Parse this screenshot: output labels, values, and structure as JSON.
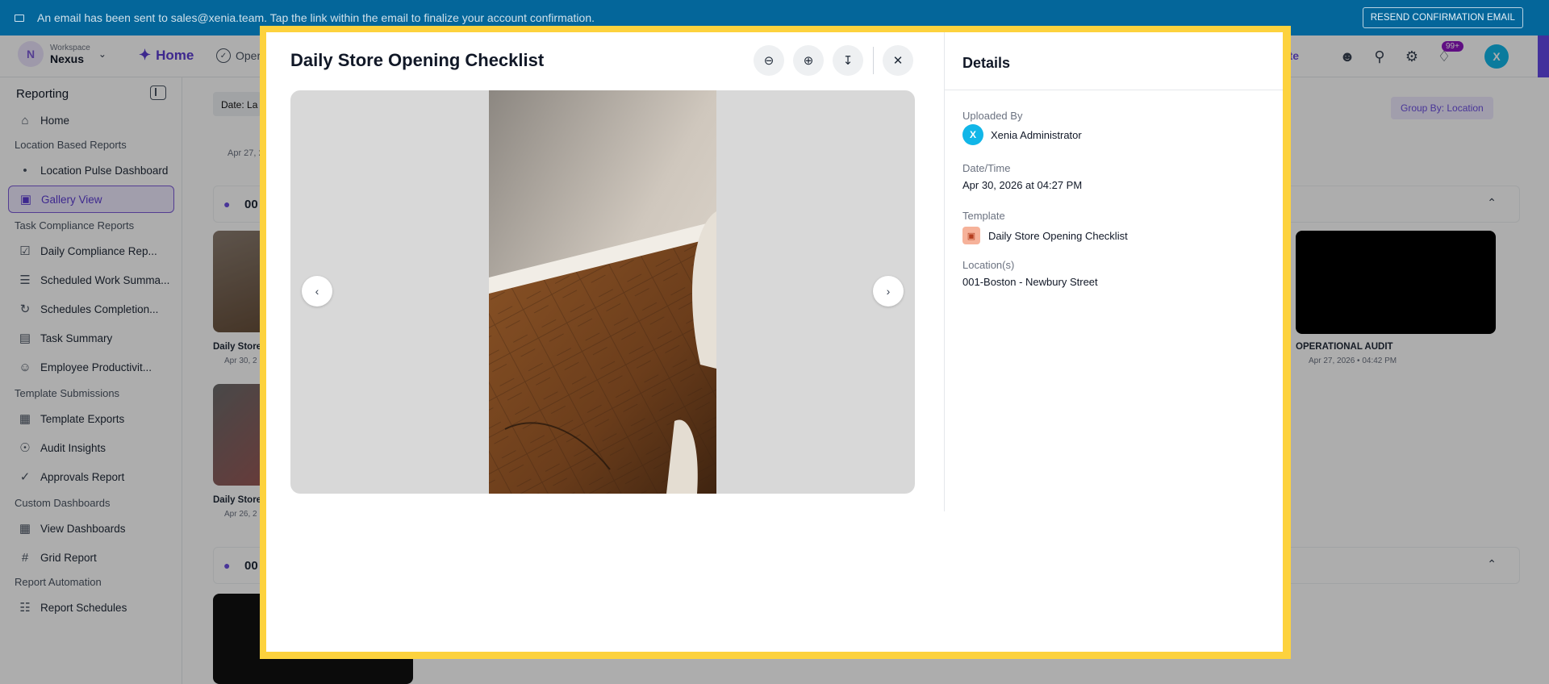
{
  "banner": {
    "message": "An email has been sent to sales@xenia.team. Tap the link within the email to finalize your account confirmation.",
    "resend_label": "RESEND CONFIRMATION EMAIL"
  },
  "topnav": {
    "workspace_label": "Workspace",
    "workspace_name": "Nexus",
    "workspace_initial": "N",
    "home_label": "Home",
    "ops_label": "Oper",
    "create_label": "eate",
    "notif_badge": "99+",
    "user_initial": "X"
  },
  "sidebar": {
    "title": "Reporting",
    "home": "Home",
    "sections": {
      "location": "Location Based Reports",
      "task": "Task Compliance Reports",
      "template": "Template Submissions",
      "custom": "Custom Dashboards",
      "automation": "Report Automation"
    },
    "items": {
      "pulse": "Location Pulse Dashboard",
      "gallery": "Gallery View",
      "daily": "Daily Compliance Rep...",
      "scheduled": "Scheduled Work Summa...",
      "completion": "Schedules Completion...",
      "task_summary": "Task Summary",
      "employee": "Employee Productivit...",
      "exports": "Template Exports",
      "audit": "Audit Insights",
      "approvals": "Approvals Report",
      "dashboards": "View Dashboards",
      "grid": "Grid Report",
      "schedules": "Report Schedules"
    }
  },
  "main": {
    "filter_label": "Date: La",
    "group_by": "Group By: Location",
    "date_top": "Apr 27, 2",
    "loc1": "00",
    "loc2": "00",
    "card1_title": "Daily Store",
    "card1_date": "Apr 30, 2",
    "card2_title": "Daily Store",
    "card2_date": "Apr 26, 2",
    "card_audit_title": "OPERATIONAL AUDIT",
    "card_audit_date": "Apr 27, 2026 • 04:42 PM"
  },
  "modal": {
    "title": "Daily Store Opening Checklist",
    "details_heading": "Details",
    "uploaded_by_label": "Uploaded By",
    "uploaded_by_initial": "X",
    "uploaded_by": "Xenia Administrator",
    "datetime_label": "Date/Time",
    "datetime": "Apr 30, 2026 at 04:27 PM",
    "template_label": "Template",
    "template": "Daily Store Opening Checklist",
    "locations_label": "Location(s)",
    "location": "001-Boston - Newbury Street"
  },
  "colors": {
    "accent": "#6c4fe0",
    "banner": "#04669a",
    "modal_frame": "#fdd23d",
    "avatar": "#11b6e8"
  }
}
